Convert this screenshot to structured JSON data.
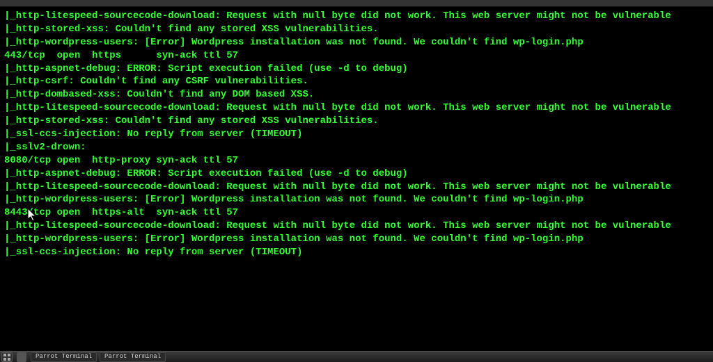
{
  "terminal": {
    "lines": [
      "|_http-litespeed-sourcecode-download: Request with null byte did not work. This web server might not be vulnerable",
      "|_http-stored-xss: Couldn't find any stored XSS vulnerabilities.",
      "|_http-wordpress-users: [Error] Wordpress installation was not found. We couldn't find wp-login.php",
      "443/tcp  open  https      syn-ack ttl 57",
      "|_http-aspnet-debug: ERROR: Script execution failed (use -d to debug)",
      "|_http-csrf: Couldn't find any CSRF vulnerabilities.",
      "|_http-dombased-xss: Couldn't find any DOM based XSS.",
      "|_http-litespeed-sourcecode-download: Request with null byte did not work. This web server might not be vulnerable",
      "|_http-stored-xss: Couldn't find any stored XSS vulnerabilities.",
      "|_ssl-ccs-injection: No reply from server (TIMEOUT)",
      "|_sslv2-drown: ",
      "8080/tcp open  http-proxy syn-ack ttl 57",
      "|_http-aspnet-debug: ERROR: Script execution failed (use -d to debug)",
      "|_http-litespeed-sourcecode-download: Request with null byte did not work. This web server might not be vulnerable",
      "|_http-wordpress-users: [Error] Wordpress installation was not found. We couldn't find wp-login.php",
      "8443/tcp open  https-alt  syn-ack ttl 57",
      "|_http-litespeed-sourcecode-download: Request with null byte did not work. This web server might not be vulnerable",
      "|_http-wordpress-users: [Error] Wordpress installation was not found. We couldn't find wp-login.php",
      "|_ssl-ccs-injection: No reply from server (TIMEOUT)"
    ]
  },
  "taskbar": {
    "items": [
      "Parrot Terminal",
      "Parrot Terminal"
    ]
  }
}
